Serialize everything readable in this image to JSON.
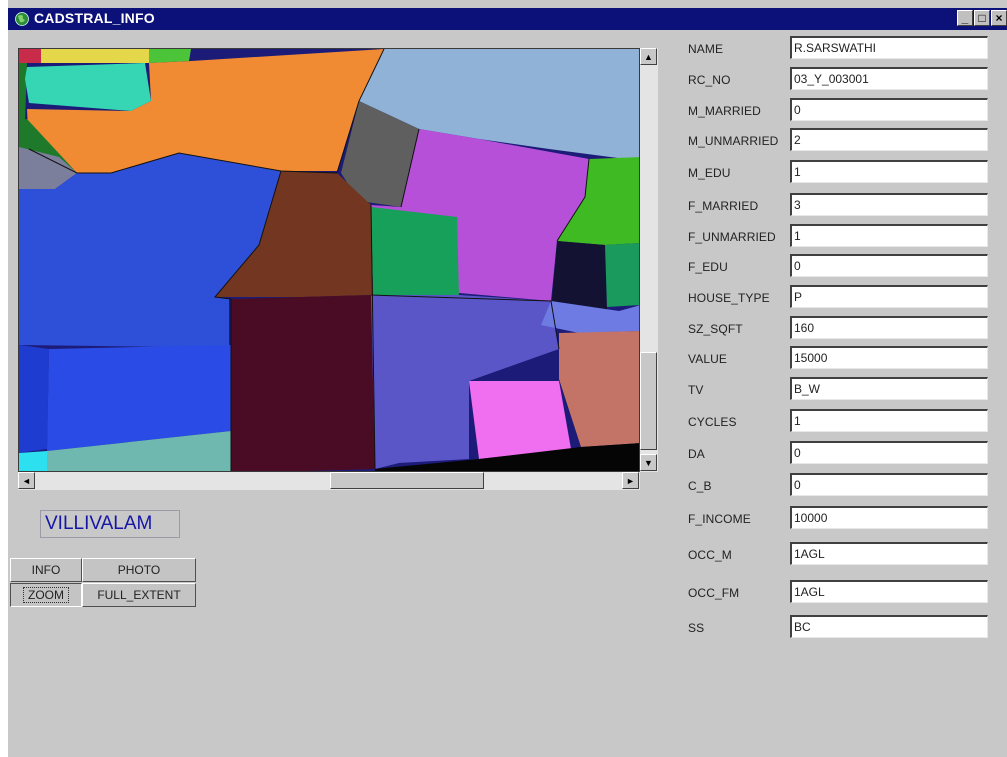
{
  "window": {
    "title": "CADSTRAL_INFO",
    "controls": {
      "minimize": "_",
      "maximize": "□",
      "close": "×"
    }
  },
  "colors": {
    "titlebar": "#0c1079",
    "window_bg": "#c8c8c8",
    "village_text": "#1515a6"
  },
  "map": {
    "village_name": "VILLIVALAM",
    "scroll": {
      "up": "▲",
      "down": "▼",
      "left": "◄",
      "right": "►"
    }
  },
  "buttons": {
    "info": "INFO",
    "photo": "PHOTO",
    "zoom": "ZOOM",
    "full_extent": "FULL_EXTENT"
  },
  "fields": [
    {
      "label": "NAME",
      "value": "R.SARSWATHI"
    },
    {
      "label": "RC_NO",
      "value": "03_Y_003001"
    },
    {
      "label": "M_MARRIED",
      "value": "0"
    },
    {
      "label": "M_UNMARRIED",
      "value": "2"
    },
    {
      "label": "M_EDU",
      "value": "1"
    },
    {
      "label": "F_MARRIED",
      "value": "3"
    },
    {
      "label": "F_UNMARRIED",
      "value": "1"
    },
    {
      "label": "F_EDU",
      "value": "0"
    },
    {
      "label": "HOUSE_TYPE",
      "value": "P"
    },
    {
      "label": "SZ_SQFT",
      "value": "160"
    },
    {
      "label": "VALUE",
      "value": "15000"
    },
    {
      "label": "TV",
      "value": "B_W"
    },
    {
      "label": "CYCLES",
      "value": "1"
    },
    {
      "label": "DA",
      "value": "0"
    },
    {
      "label": "C_B",
      "value": "0"
    },
    {
      "label": "F_INCOME",
      "value": "10000"
    },
    {
      "label": "OCC_M",
      "value": "1AGL"
    },
    {
      "label": "OCC_FM",
      "value": "1AGL"
    },
    {
      "label": "SS",
      "value": "BC"
    }
  ]
}
